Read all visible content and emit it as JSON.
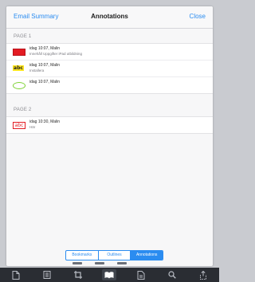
{
  "navbar": {
    "left_label": "Email Summary",
    "title": "Annotations",
    "right_label": "Close"
  },
  "sections": [
    {
      "header": "PAGE 1",
      "items": [
        {
          "icon": "red-highlight-icon",
          "meta": "idag 10:07, Malin",
          "detail": "Innehåll Uppgifter iPad utbildning"
        },
        {
          "icon": "abc-highlight-icon",
          "meta": "idag 10:07, Malin",
          "detail": "Installera"
        },
        {
          "icon": "ellipse-icon",
          "meta": "idag 10:07, Malin",
          "detail": ""
        }
      ]
    },
    {
      "header": "PAGE 2",
      "items": [
        {
          "icon": "abc-text-icon",
          "meta": "idag 10:30, Malin",
          "detail": "Här"
        }
      ]
    }
  ],
  "tabs": [
    {
      "label": "Bookmarks",
      "active": false
    },
    {
      "label": "Outlines",
      "active": false
    },
    {
      "label": "Annotations",
      "active": true
    }
  ],
  "toolbar_icons": [
    "document-icon",
    "list-icon",
    "crop-icon",
    "book-icon",
    "page-icon",
    "search-icon",
    "share-icon"
  ],
  "colors": {
    "accent": "#2b8cf0",
    "red": "#e31b23",
    "yellow": "#ffe61c",
    "green": "#7bd12f",
    "toolbar_bg": "#2a2d33"
  }
}
